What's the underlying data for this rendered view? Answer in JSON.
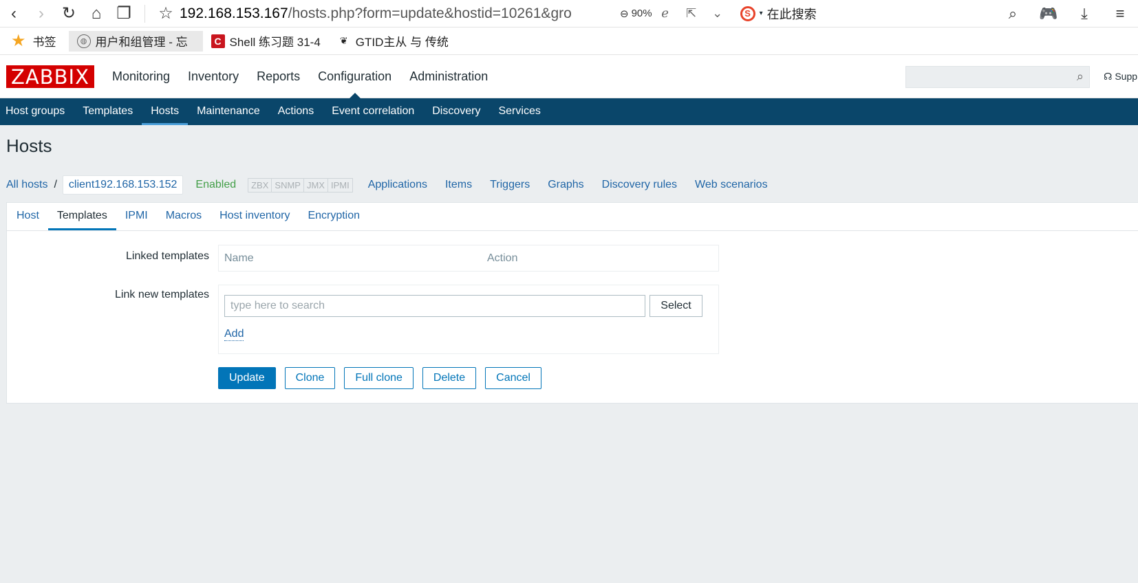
{
  "browser": {
    "url_host": "192.168.153.167",
    "url_rest": "/hosts.php?form=update&hostid=10261&gro",
    "zoom": "90%",
    "search_placeholder": "在此搜索",
    "bookmarks_label": "书签",
    "bookmarks": [
      {
        "label": "用户和组管理 - 忘",
        "icon": "globe-icon"
      },
      {
        "label": "Shell 练习题 31-4",
        "icon": "csdn-icon"
      },
      {
        "label": "GTID主从 与 传统",
        "icon": "leaf-icon"
      }
    ]
  },
  "zabbix": {
    "logo": "ZABBIX",
    "main_menu": [
      "Monitoring",
      "Inventory",
      "Reports",
      "Configuration",
      "Administration"
    ],
    "selected_main": "Configuration",
    "support": "Supp",
    "sub_menu": [
      "Host groups",
      "Templates",
      "Hosts",
      "Maintenance",
      "Actions",
      "Event correlation",
      "Discovery",
      "Services"
    ],
    "selected_sub": "Hosts"
  },
  "page": {
    "title": "Hosts",
    "breadcrumb_all": "All hosts",
    "breadcrumb_sep": "/",
    "host_name": "client192.168.153.152",
    "status": "Enabled",
    "availability": [
      "ZBX",
      "SNMP",
      "JMX",
      "IPMI"
    ],
    "host_links": [
      "Applications",
      "Items",
      "Triggers",
      "Graphs",
      "Discovery rules",
      "Web scenarios"
    ],
    "tabs": [
      "Host",
      "Templates",
      "IPMI",
      "Macros",
      "Host inventory",
      "Encryption"
    ],
    "selected_tab": "Templates"
  },
  "form": {
    "linked_label": "Linked templates",
    "col_name": "Name",
    "col_action": "Action",
    "link_new_label": "Link new templates",
    "search_placeholder": "type here to search",
    "select_label": "Select",
    "add_label": "Add",
    "buttons": {
      "update": "Update",
      "clone": "Clone",
      "full_clone": "Full clone",
      "delete": "Delete",
      "cancel": "Cancel"
    }
  },
  "colors": {
    "zabbix_red": "#d40000",
    "nav_blue": "#0a466a",
    "link_blue": "#1f65a6",
    "primary": "#0275b8",
    "enabled_green": "#429e47"
  }
}
